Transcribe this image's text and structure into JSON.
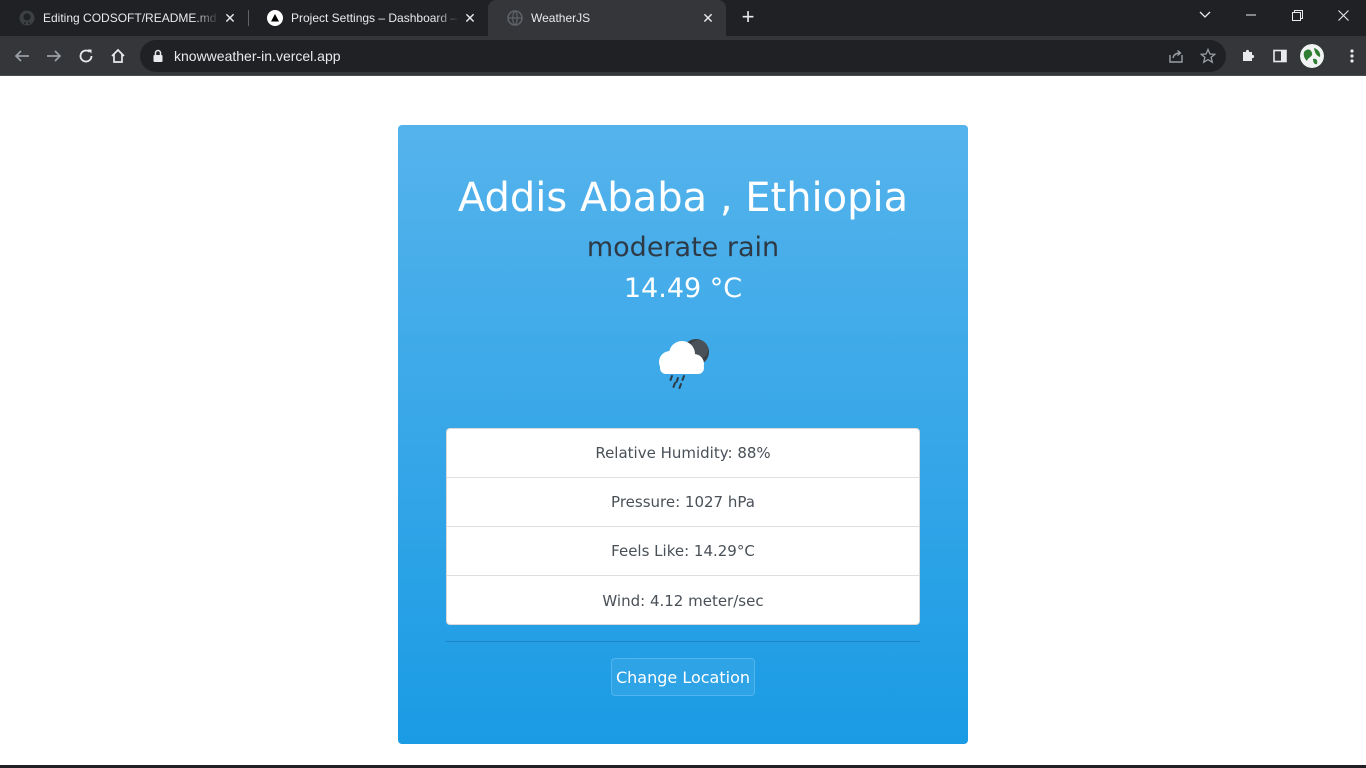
{
  "browser": {
    "tabs": [
      {
        "title": "Editing CODSOFT/README.md at",
        "icon": "github-icon"
      },
      {
        "title": "Project Settings – Dashboard – V",
        "icon": "vercel-icon"
      },
      {
        "title": "WeatherJS",
        "icon": "globe-icon",
        "active": true
      }
    ],
    "url": "knowweather-in.vercel.app"
  },
  "weather": {
    "location": "Addis Ababa , Ethiopia",
    "condition": "moderate rain",
    "temperature": "14.49 °C",
    "icon": "rain-cloud-night-icon",
    "details": [
      "Relative Humidity: 88%",
      "Pressure: 1027 hPa",
      "Feels Like: 14.29°C",
      "Wind: 4.12 meter/sec"
    ],
    "change_location_label": "Change Location"
  },
  "colors": {
    "card_top": "#55b3ec",
    "card_bottom": "#1a9be4",
    "button": "#2ea3e6",
    "chrome_dark": "#202124",
    "chrome_toolbar": "#35363a"
  }
}
